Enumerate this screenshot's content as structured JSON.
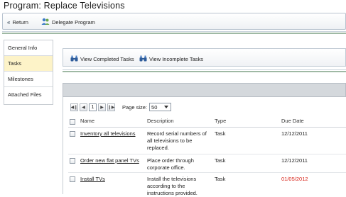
{
  "page": {
    "title": "Program: Replace Televisions"
  },
  "toolbar": {
    "return_label": "Return",
    "return_icon": "double-chevron-left-icon",
    "delegate_label": "Delegate Program",
    "delegate_icon": "delegate-people-icon"
  },
  "sidebar": {
    "items": [
      {
        "label": "General Info",
        "active": false
      },
      {
        "label": "Tasks",
        "active": true
      },
      {
        "label": "Milestones",
        "active": false
      },
      {
        "label": "Attached Files",
        "active": false
      }
    ]
  },
  "tasks_toolbar": {
    "view_completed_label": "View Completed Tasks",
    "view_incomplete_label": "View Incomplete Tasks",
    "icon": "binoculars-icon"
  },
  "pager": {
    "current_page": "1",
    "page_size_label": "Page size:",
    "page_size_value": "50"
  },
  "grid": {
    "columns": [
      "Name",
      "Description",
      "Type",
      "Due Date"
    ],
    "rows": [
      {
        "name": "Inventory all televisions",
        "description": [
          "Record serial numbers of",
          "all televisions to be",
          "replaced."
        ],
        "type": "Task",
        "due_date": "12/12/2011",
        "overdue": false
      },
      {
        "name": "Order new flat panel TVs",
        "description": [
          "Place order through",
          "corporate office."
        ],
        "type": "Task",
        "due_date": "12/12/2011",
        "overdue": false
      },
      {
        "name": "Install TVs",
        "description": [
          "Install the televisions",
          "according to the",
          "instructions provided."
        ],
        "type": "Task",
        "due_date": "01/05/2012",
        "overdue": true
      }
    ]
  },
  "colors": {
    "overdue": "#d9261c",
    "active_tab": "#fdf3c8",
    "accent_line": "#9fb9a4"
  }
}
